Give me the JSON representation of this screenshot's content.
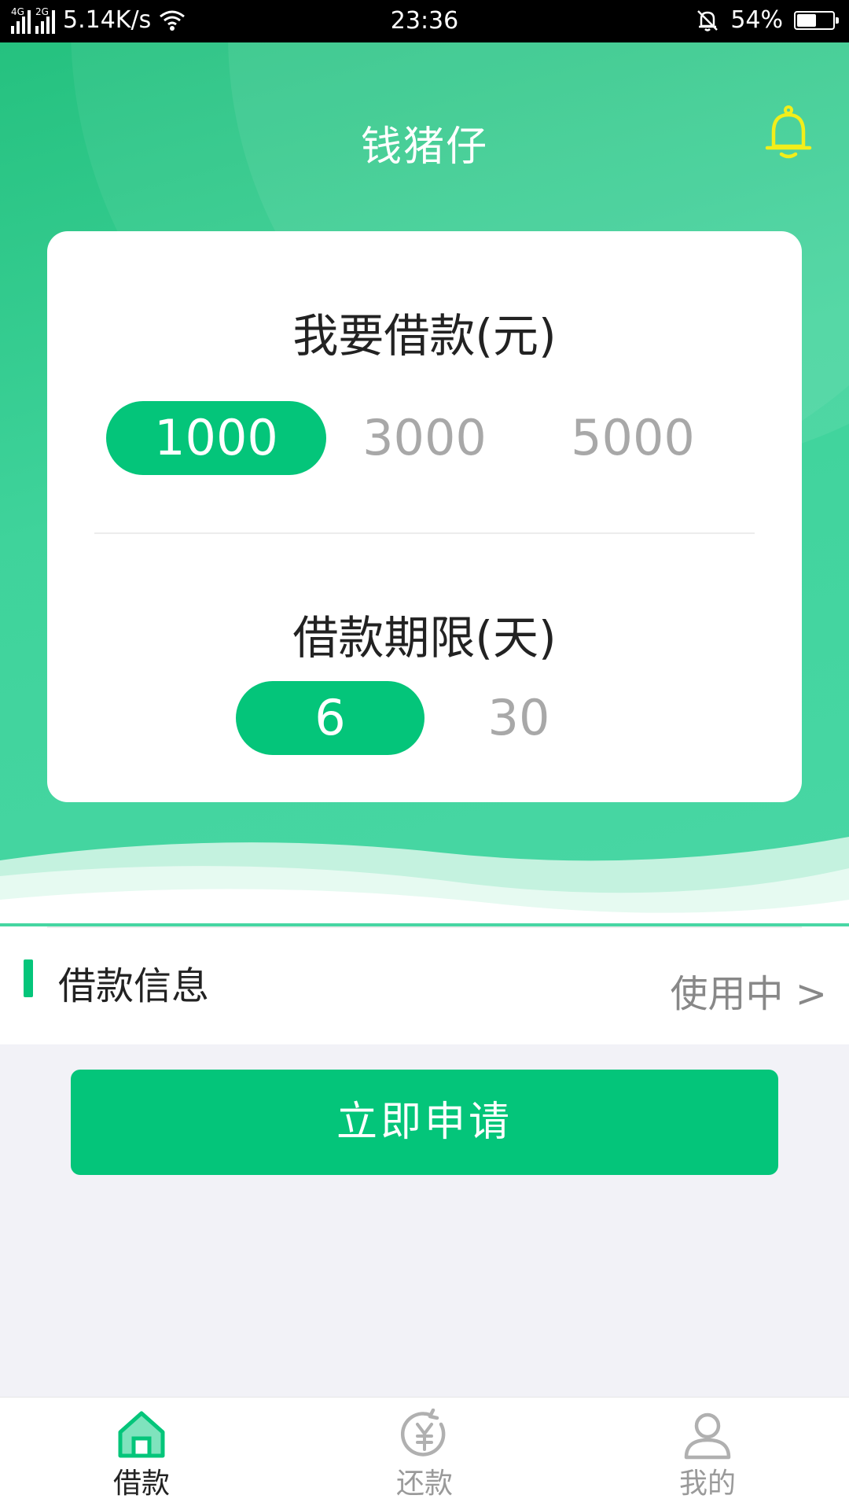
{
  "status_bar": {
    "net1": "4G",
    "net2": "2G",
    "speed": "5.14K/s",
    "time": "23:36",
    "battery": "54%",
    "battery_level": 0.54
  },
  "header": {
    "title": "钱猪仔",
    "bell_icon": "bell-icon"
  },
  "loan_card": {
    "amount_title": "我要借款(元)",
    "amount_options": [
      "1000",
      "3000",
      "5000"
    ],
    "selected_amount": "1000",
    "term_title": "借款期限(天)",
    "term_options": [
      "6",
      "30"
    ],
    "selected_term": "6"
  },
  "info": {
    "label": "借款信息",
    "status": "使用中 >"
  },
  "apply": {
    "label": "立即申请"
  },
  "bottom_nav": {
    "items": [
      {
        "label": "借款",
        "icon": "home-icon",
        "active": true
      },
      {
        "label": "还款",
        "icon": "repay-yuan-icon",
        "active": false
      },
      {
        "label": "我的",
        "icon": "user-icon",
        "active": false
      }
    ]
  },
  "colors": {
    "accent": "#04c57a",
    "bell": "#f2ee1a",
    "hero_start": "#25c17f",
    "hero_end": "#49d7a5"
  }
}
